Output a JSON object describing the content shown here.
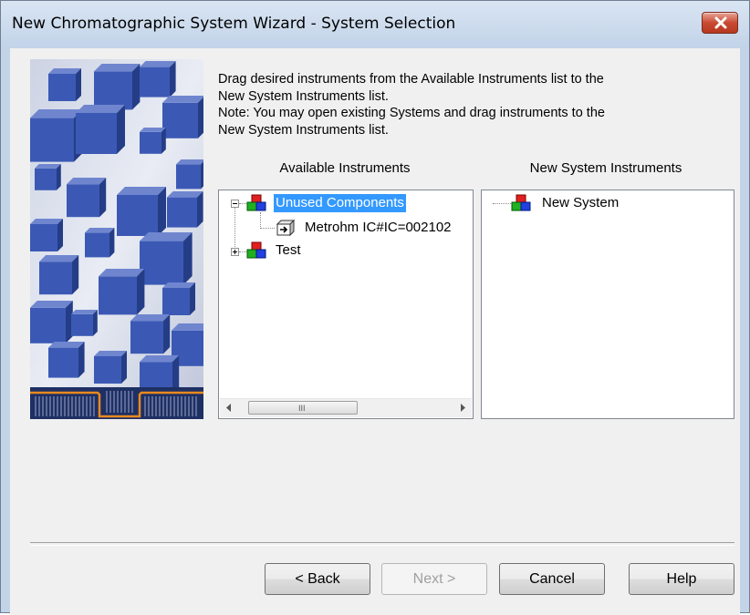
{
  "window": {
    "title": "New Chromatographic System Wizard - System Selection"
  },
  "instructions": {
    "line1": "Drag desired instruments from the Available Instruments list to the",
    "line2": "New System Instruments list.",
    "line3": "Note:  You may open existing Systems and drag instruments to the",
    "line4": "New System Instruments list."
  },
  "available": {
    "label": "Available Instruments",
    "nodes": [
      {
        "label": "Unused Components",
        "expanded": true,
        "selected": true
      },
      {
        "label": "Metrohm IC#IC=002102",
        "expanded": false,
        "selected": false
      },
      {
        "label": "Test",
        "expanded": false,
        "selected": false
      }
    ],
    "scrollbar_grip": "III"
  },
  "new_system": {
    "label": "New System Instruments",
    "nodes": [
      {
        "label": "New System"
      }
    ]
  },
  "buttons": {
    "back": "< Back",
    "next": "Next >",
    "cancel": "Cancel",
    "help": "Help"
  },
  "colors": {
    "selection": "#3399ff",
    "cube_blue": "#3b59b4",
    "accent_orange": "#e8891e"
  },
  "icons": {
    "close": "close-icon",
    "system": "system-node-icon",
    "instrument": "instrument-icon"
  }
}
